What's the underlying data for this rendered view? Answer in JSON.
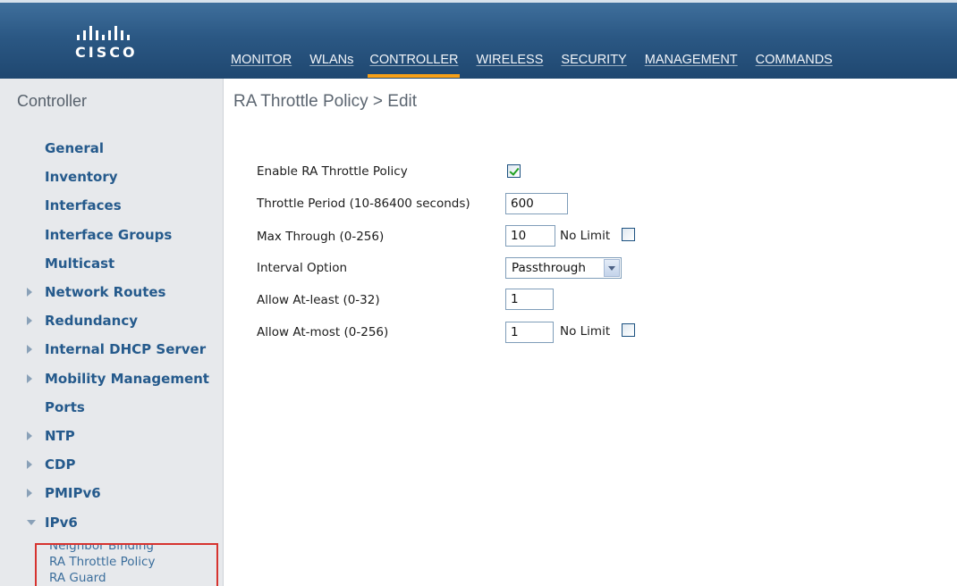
{
  "brand": {
    "logo_text": "CISCO"
  },
  "nav": [
    {
      "label": "MONITOR",
      "active": false
    },
    {
      "label": "WLANs",
      "active": false
    },
    {
      "label": "CONTROLLER",
      "active": true
    },
    {
      "label": "WIRELESS",
      "active": false
    },
    {
      "label": "SECURITY",
      "active": false
    },
    {
      "label": "MANAGEMENT",
      "active": false
    },
    {
      "label": "COMMANDS",
      "active": false
    }
  ],
  "sidebar": {
    "title": "Controller",
    "items": [
      {
        "label": "General",
        "arrow": "none"
      },
      {
        "label": "Inventory",
        "arrow": "none"
      },
      {
        "label": "Interfaces",
        "arrow": "none"
      },
      {
        "label": "Interface Groups",
        "arrow": "none"
      },
      {
        "label": "Multicast",
        "arrow": "none"
      },
      {
        "label": "Network Routes",
        "arrow": "right"
      },
      {
        "label": "Redundancy",
        "arrow": "right"
      },
      {
        "label": "Internal DHCP Server",
        "arrow": "right"
      },
      {
        "label": "Mobility Management",
        "arrow": "right"
      },
      {
        "label": "Ports",
        "arrow": "none"
      },
      {
        "label": "NTP",
        "arrow": "right"
      },
      {
        "label": "CDP",
        "arrow": "right"
      },
      {
        "label": "PMIPv6",
        "arrow": "right"
      },
      {
        "label": "IPv6",
        "arrow": "down"
      }
    ],
    "subitems": [
      {
        "label": "Neighbor Binding"
      },
      {
        "label": "RA Throttle Policy"
      },
      {
        "label": "RA Guard"
      }
    ]
  },
  "main": {
    "title": "RA Throttle Policy > Edit",
    "form": {
      "enable_label": "Enable RA Throttle Policy",
      "enable_checked": true,
      "period_label": "Throttle Period (10-86400 seconds)",
      "period_value": "600",
      "max_label": "Max Through (0-256)",
      "max_value": "10",
      "max_nolimit_label": "No Limit",
      "max_nolimit_checked": false,
      "interval_label": "Interval Option",
      "interval_value": "Passthrough",
      "atleast_label": "Allow At-least (0-32)",
      "atleast_value": "1",
      "atmost_label": "Allow At-most (0-256)",
      "atmost_value": "1",
      "atmost_nolimit_label": "No Limit",
      "atmost_nolimit_checked": false
    }
  },
  "colors": {
    "header": "#2b5884",
    "active_tab": "#f6a018",
    "sidebar_bg": "#e7e9ec",
    "sidebar_link": "#255a8c",
    "highlight_box": "#d6332f",
    "checkmark": "#21a121"
  }
}
